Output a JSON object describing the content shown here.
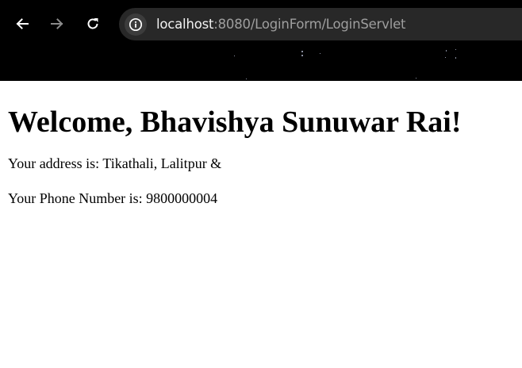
{
  "browser": {
    "url_host": "localhost",
    "url_path": ":8080/LoginForm/LoginServlet",
    "icons": {
      "back": "arrow-left-icon",
      "forward": "arrow-right-icon",
      "reload": "reload-icon",
      "site_info": "info-circle-icon"
    },
    "colors": {
      "chrome_bg": "#000000",
      "omnibox_bg": "#282828",
      "url_host": "#f2f2f2",
      "url_path": "#9e9e9e"
    }
  },
  "page": {
    "heading": "Welcome, Bhavishya Sunuwar Rai!",
    "address_line": "Your address is: Tikathali, Lalitpur &",
    "phone_line": "Your Phone Number is: 9800000004"
  }
}
